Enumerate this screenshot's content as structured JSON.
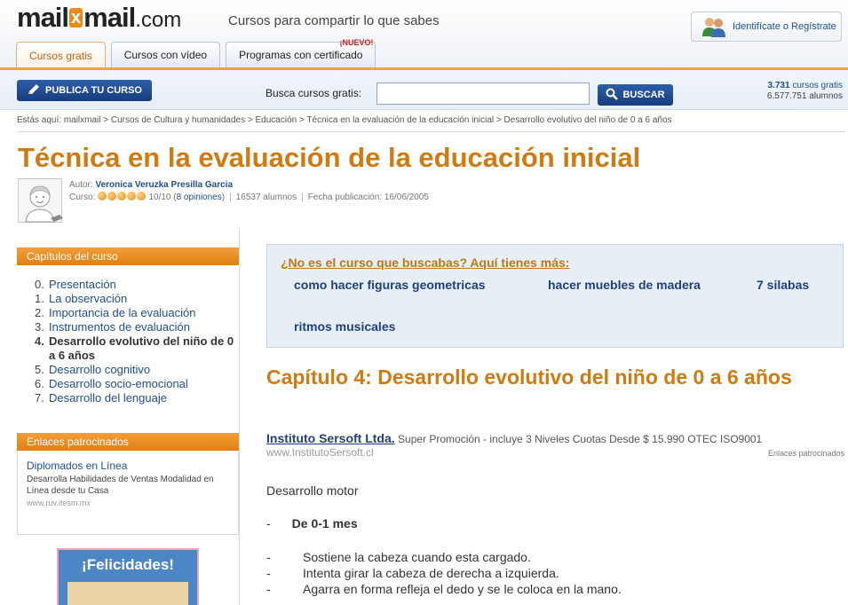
{
  "header": {
    "logo": {
      "part1": "mail",
      "x": "x",
      "part2": "mail",
      "tld": ".com"
    },
    "tagline": "Cursos para compartir lo que sabes",
    "login_label": "Identifícate o Regístrate"
  },
  "tabs": [
    {
      "label": "Cursos gratis",
      "active": true
    },
    {
      "label": "Cursos con vídeo",
      "active": false
    },
    {
      "label": "Programas con certificado",
      "badge": "¡NUEVO!",
      "active": false
    }
  ],
  "toolbar": {
    "publish_label": "PUBLICA TU CURSO",
    "search_label": "Busca cursos gratis:",
    "search_value": "",
    "search_button": "BUSCAR",
    "stats_courses_num": "3.731",
    "stats_courses_label": "cursos gratis",
    "stats_students": "6.577.751 alumnos"
  },
  "breadcrumb": {
    "prefix": "Estás aquí:",
    "items": [
      "mailxmail",
      "Cursos de Cultura y humanidades",
      "Educación",
      "Técnica en la evaluación de la educación inicial",
      "Desarrollo evolutivo del niño de 0 a 6 años"
    ],
    "sep": " > "
  },
  "course": {
    "title": "Técnica en la evaluación de la educación inicial",
    "author_label": "Autor:",
    "author": "Veronica Veruzka Presilla Garcia",
    "rating_label": "Curso:",
    "rating_value": 5,
    "rating_max": 5,
    "score": "10/10 (",
    "opinions": "8 opiniones",
    "score_close": ")",
    "students": "16537 alumnos",
    "published": "Fecha publicación: 16/06/2005"
  },
  "sidebar": {
    "chapters_title": "Capítulos del curso",
    "chapters": [
      {
        "n": "0.",
        "label": "Presentación"
      },
      {
        "n": "1.",
        "label": "La observación"
      },
      {
        "n": "2.",
        "label": "Importancia de la evaluación"
      },
      {
        "n": "3.",
        "label": "Instrumentos de evaluación"
      },
      {
        "n": "4.",
        "label": "Desarrollo evolutivo del niño de 0 a 6 años",
        "current": true
      },
      {
        "n": "5.",
        "label": "Desarrollo cognitivo"
      },
      {
        "n": "6.",
        "label": "Desarrollo socio-emocional"
      },
      {
        "n": "7.",
        "label": "Desarrollo del lenguaje"
      }
    ],
    "sponsored_title": "Enlaces patrocinados",
    "sponsored": {
      "title": "Diplomados en Línea",
      "desc": "Desarrolla Habilidades de Ventas Modalidad en Línea desde tu Casa",
      "url": "www.ruv.itesm.mx"
    },
    "banner_text": "¡Felicidades!"
  },
  "suggest": {
    "heading": "¿No es el curso que buscabas? Aquí tienes más:",
    "items": [
      "como hacer figuras geometricas",
      "hacer muebles de madera",
      "7 silabas",
      "ritmos musicales"
    ]
  },
  "chapter": {
    "title": "Capítulo 4: Desarrollo evolutivo del niño de 0 a 6 años"
  },
  "ad": {
    "name": "Instituto Sersoft Ltda.",
    "text": "Super Promoción - incluye 3 Niveles Cuotas Desde $ 15.990 OTEC ISO9001",
    "url": "www.InstitutoSersoft.cl",
    "label": "Enlaces patrocinados"
  },
  "content": {
    "section": "Desarrollo motor",
    "subsection_dash": "-",
    "subsection": "De 0-1 mes",
    "bullets": [
      "Sostiene la cabeza cuando esta cargado.",
      "Intenta girar la cabeza de derecha a izquierda.",
      "Agarra en forma refleja el dedo y se le coloca en la mano."
    ],
    "bullet_dash": "-"
  }
}
